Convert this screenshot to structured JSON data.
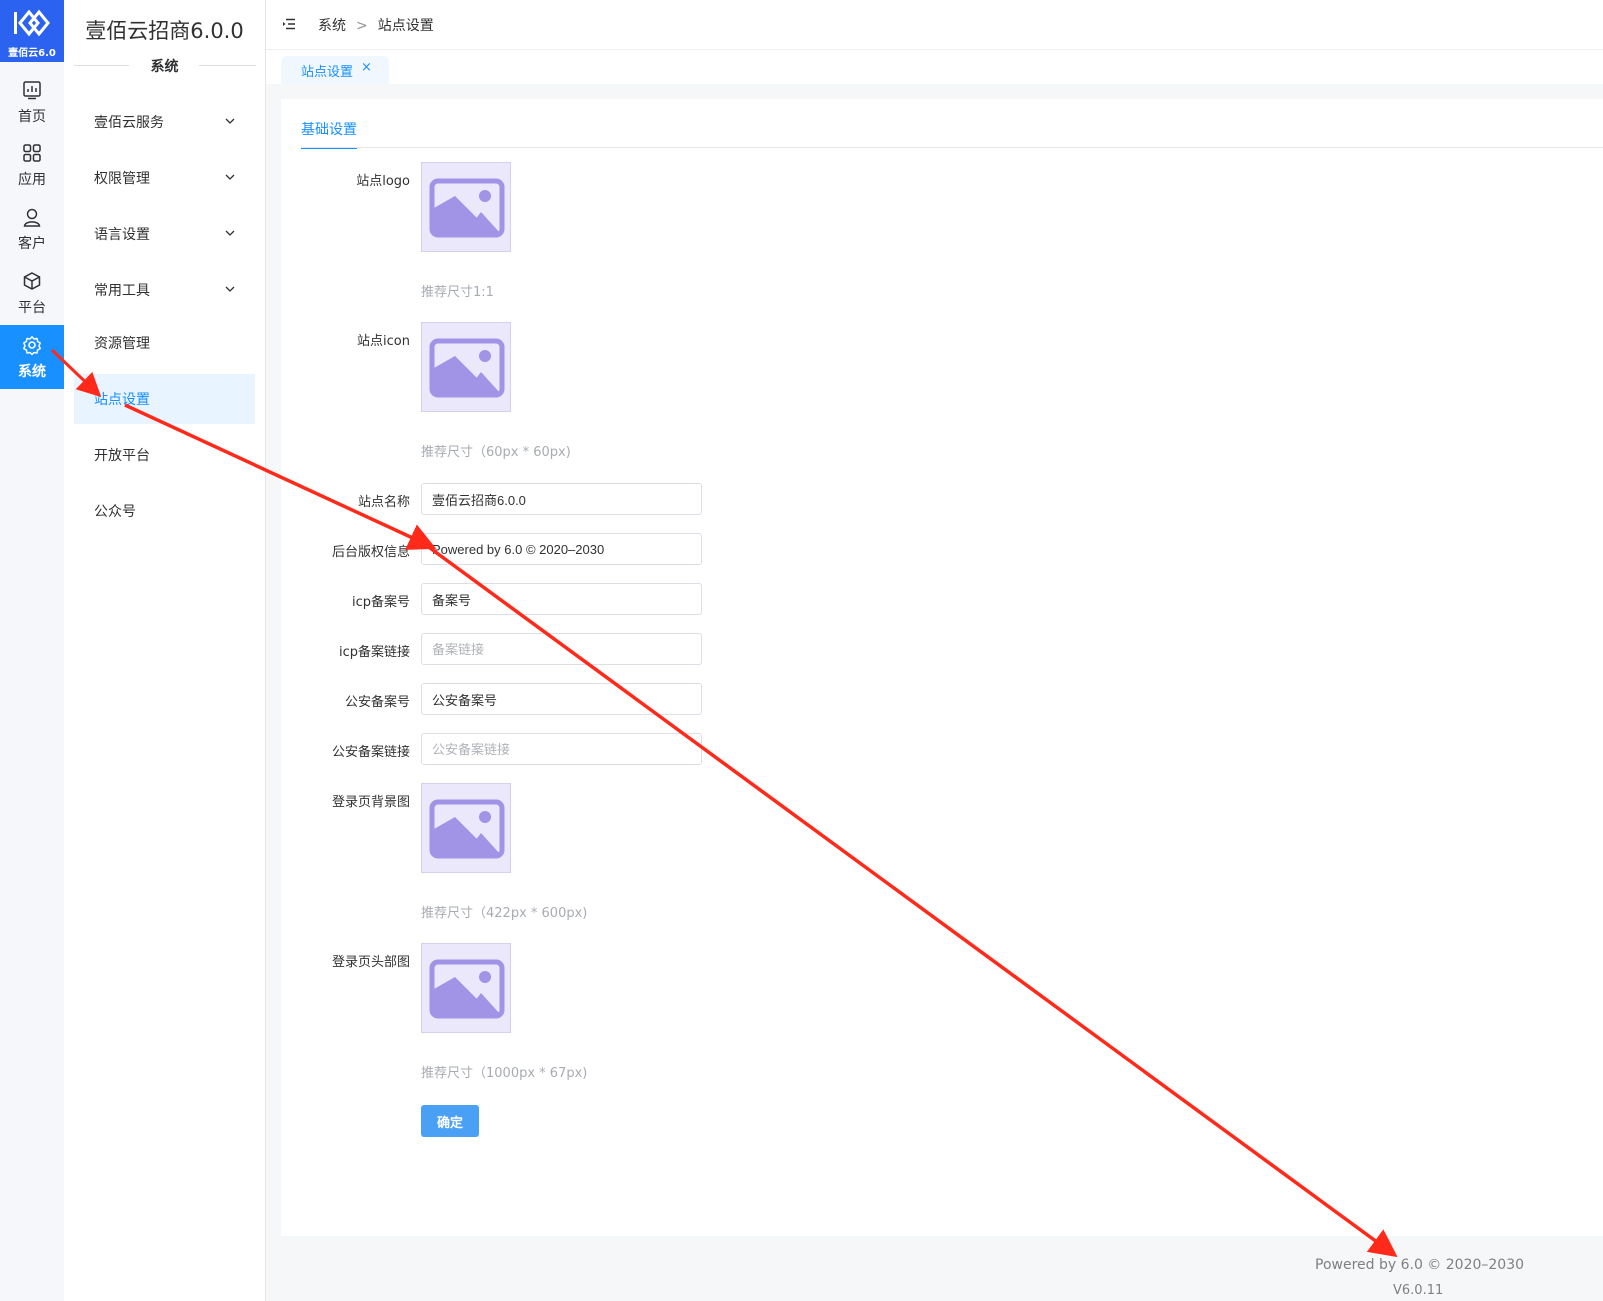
{
  "app": {
    "logo_text": "壹佰云6.0",
    "title": "壹佰云招商6.0.0",
    "section": "系统"
  },
  "rail": {
    "items": [
      {
        "label": "首页",
        "icon": "dashboard-icon"
      },
      {
        "label": "应用",
        "icon": "apps-grid-icon"
      },
      {
        "label": "客户",
        "icon": "user-icon"
      },
      {
        "label": "平台",
        "icon": "cube-icon"
      },
      {
        "label": "系统",
        "icon": "gear-icon",
        "active": true
      }
    ]
  },
  "sidebar": {
    "items": [
      {
        "label": "壹佰云服务",
        "expandable": true
      },
      {
        "label": "权限管理",
        "expandable": true
      },
      {
        "label": "语言设置",
        "expandable": true
      },
      {
        "label": "常用工具",
        "expandable": true
      },
      {
        "label": "资源管理"
      },
      {
        "label": "站点设置",
        "active": true
      },
      {
        "label": "开放平台"
      },
      {
        "label": "公众号"
      }
    ]
  },
  "breadcrumb": {
    "items": [
      "系统",
      "站点设置"
    ],
    "separator": ">"
  },
  "tags": {
    "active_label": "站点设置",
    "close_glyph": "×"
  },
  "form": {
    "tab": "基础设置",
    "logo": {
      "label": "站点logo",
      "hint": "推荐尺寸1:1"
    },
    "icon": {
      "label": "站点icon",
      "hint": "推荐尺寸（60px * 60px)"
    },
    "site_name": {
      "label": "站点名称",
      "value": "壹佰云招商6.0.0",
      "placeholder": ""
    },
    "copyright": {
      "label": "后台版权信息",
      "value": "Powered by 6.0 © 2020–2030",
      "placeholder": ""
    },
    "icp": {
      "label": "icp备案号",
      "value": "备案号",
      "placeholder": ""
    },
    "icp_link": {
      "label": "icp备案链接",
      "value": "",
      "placeholder": "备案链接"
    },
    "police": {
      "label": "公安备案号",
      "value": "公安备案号",
      "placeholder": ""
    },
    "police_link": {
      "label": "公安备案链接",
      "value": "",
      "placeholder": "公安备案链接"
    },
    "login_bg": {
      "label": "登录页背景图",
      "hint": "推荐尺寸（422px * 600px)"
    },
    "login_header": {
      "label": "登录页头部图",
      "hint": "推荐尺寸（1000px * 67px)"
    },
    "submit_label": "确定"
  },
  "footer": {
    "copyright": "Powered by 6.0 © 2020–2030",
    "version": "V6.0.11"
  },
  "colors": {
    "primary": "#1890ff",
    "logo_bg": "#2b63f0",
    "annotation_arrow": "#ff2a1a",
    "placeholder_image": "#a193e6"
  }
}
